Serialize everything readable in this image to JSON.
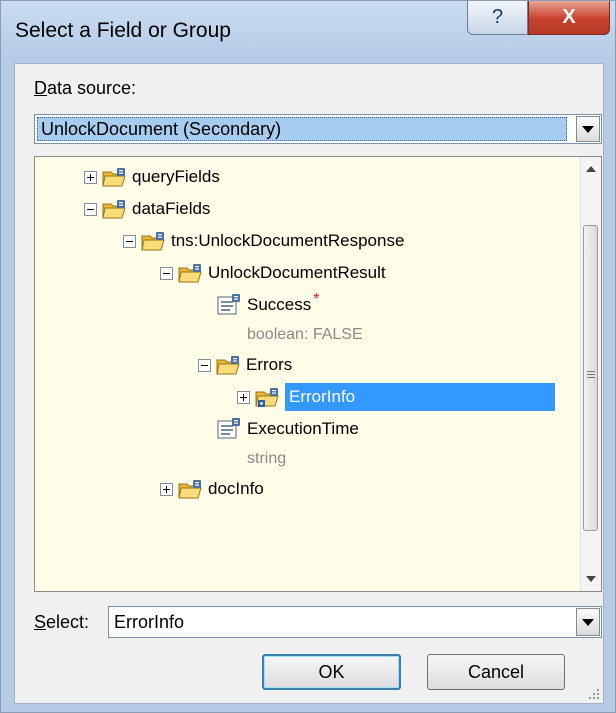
{
  "window": {
    "title": "Select a Field or Group",
    "help_label": "?",
    "close_label": "X"
  },
  "data_source": {
    "label_accel": "D",
    "label_rest": "ata source:",
    "value": "UnlockDocument (Secondary)"
  },
  "tree": [
    {
      "label": "queryFields",
      "kind": "group",
      "expander": "plus"
    },
    {
      "label": "dataFields",
      "kind": "group",
      "expander": "minus"
    },
    {
      "label": "tns:UnlockDocumentResponse",
      "kind": "group",
      "expander": "minus"
    },
    {
      "label": "UnlockDocumentResult",
      "kind": "group",
      "expander": "minus"
    },
    {
      "label": "Success",
      "kind": "field",
      "required_mark": "*",
      "type": "boolean: FALSE"
    },
    {
      "label": "Errors",
      "kind": "group",
      "expander": "minus"
    },
    {
      "label": "ErrorInfo",
      "kind": "group",
      "expander": "plus",
      "selected": true
    },
    {
      "label": "ExecutionTime",
      "kind": "field",
      "type": "string"
    },
    {
      "label": "docInfo",
      "kind": "group",
      "expander": "plus"
    }
  ],
  "select": {
    "label_accel": "S",
    "label_rest": "elect:",
    "value": "ErrorInfo"
  },
  "buttons": {
    "ok": "OK",
    "cancel": "Cancel"
  },
  "colors": {
    "selection": "#3399ff",
    "tree_background": "#fffce8",
    "required": "#e02020"
  }
}
